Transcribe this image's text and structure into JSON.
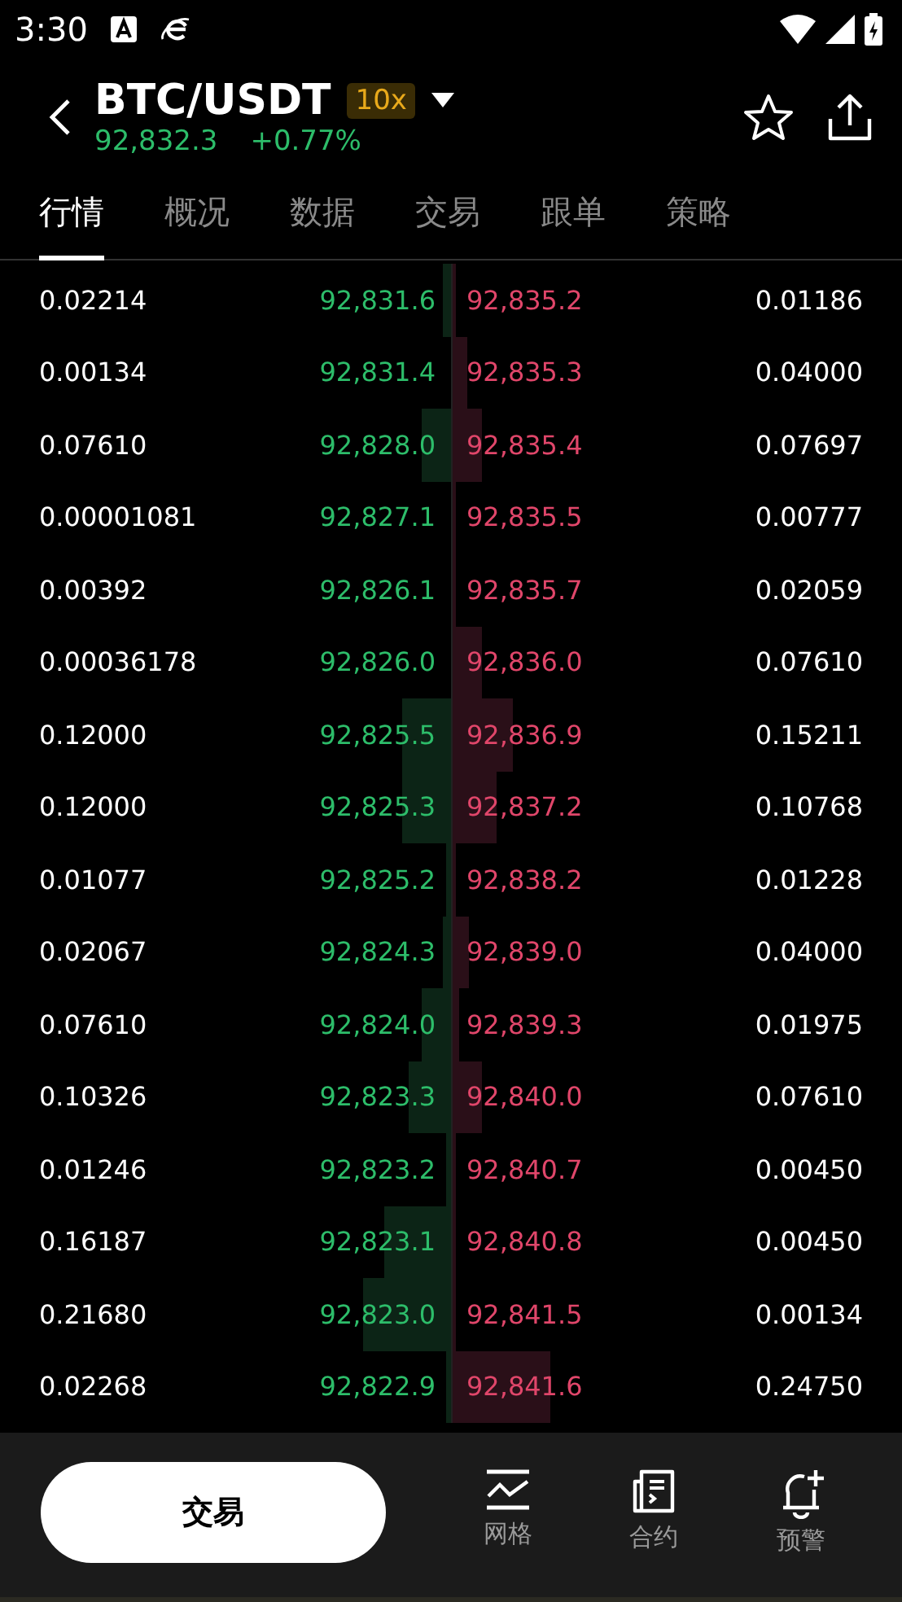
{
  "status_bar": {
    "time": "3:30"
  },
  "header": {
    "pair": "BTC/USDT",
    "leverage": "10x",
    "price": "92,832.3",
    "change": "+0.77%",
    "favorited": false
  },
  "tabs": [
    {
      "label": "行情",
      "selected": true
    },
    {
      "label": "概况",
      "selected": false
    },
    {
      "label": "数据",
      "selected": false
    },
    {
      "label": "交易",
      "selected": false
    },
    {
      "label": "跟单",
      "selected": false
    },
    {
      "label": "策略",
      "selected": false
    }
  ],
  "order_book": [
    {
      "bid_size": "0.02214",
      "bid_price": "92,831.6",
      "ask_price": "92,835.2",
      "ask_size": "0.01186"
    },
    {
      "bid_size": "0.00134",
      "bid_price": "92,831.4",
      "ask_price": "92,835.3",
      "ask_size": "0.04000"
    },
    {
      "bid_size": "0.07610",
      "bid_price": "92,828.0",
      "ask_price": "92,835.4",
      "ask_size": "0.07697"
    },
    {
      "bid_size": "0.00001081",
      "bid_price": "92,827.1",
      "ask_price": "92,835.5",
      "ask_size": "0.00777"
    },
    {
      "bid_size": "0.00392",
      "bid_price": "92,826.1",
      "ask_price": "92,835.7",
      "ask_size": "0.02059"
    },
    {
      "bid_size": "0.00036178",
      "bid_price": "92,826.0",
      "ask_price": "92,836.0",
      "ask_size": "0.07610"
    },
    {
      "bid_size": "0.12000",
      "bid_price": "92,825.5",
      "ask_price": "92,836.9",
      "ask_size": "0.15211"
    },
    {
      "bid_size": "0.12000",
      "bid_price": "92,825.3",
      "ask_price": "92,837.2",
      "ask_size": "0.10768"
    },
    {
      "bid_size": "0.01077",
      "bid_price": "92,825.2",
      "ask_price": "92,838.2",
      "ask_size": "0.01228"
    },
    {
      "bid_size": "0.02067",
      "bid_price": "92,824.3",
      "ask_price": "92,839.0",
      "ask_size": "0.04000"
    },
    {
      "bid_size": "0.07610",
      "bid_price": "92,824.0",
      "ask_price": "92,839.3",
      "ask_size": "0.01975"
    },
    {
      "bid_size": "0.10326",
      "bid_price": "92,823.3",
      "ask_price": "92,840.0",
      "ask_size": "0.07610"
    },
    {
      "bid_size": "0.01246",
      "bid_price": "92,823.2",
      "ask_price": "92,840.7",
      "ask_size": "0.00450"
    },
    {
      "bid_size": "0.16187",
      "bid_price": "92,823.1",
      "ask_price": "92,840.8",
      "ask_size": "0.00450"
    },
    {
      "bid_size": "0.21680",
      "bid_price": "92,823.0",
      "ask_price": "92,841.5",
      "ask_size": "0.00134"
    },
    {
      "bid_size": "0.02268",
      "bid_price": "92,822.9",
      "ask_price": "92,841.6",
      "ask_size": "0.24750"
    }
  ],
  "bottom_bar": {
    "trade_button": "交易",
    "items": [
      {
        "kind": "grid",
        "label": "网格"
      },
      {
        "kind": "contract",
        "label": "合约"
      },
      {
        "kind": "alert",
        "label": "预警"
      }
    ]
  }
}
